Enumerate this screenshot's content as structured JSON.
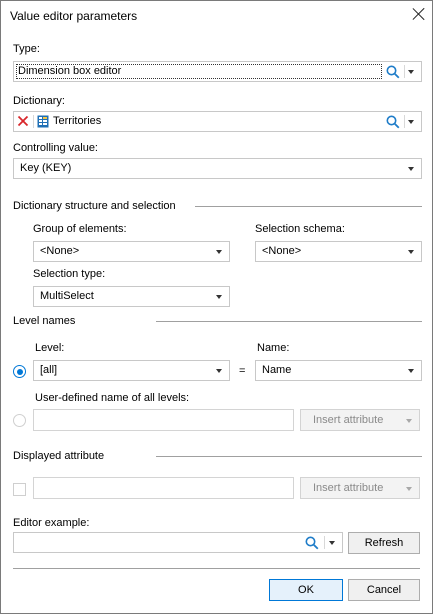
{
  "window": {
    "title": "Value editor parameters"
  },
  "type": {
    "label": "Type:",
    "value": "Dimension box editor"
  },
  "dictionary": {
    "label": "Dictionary:",
    "value": "Territories"
  },
  "controlling": {
    "label": "Controlling value:",
    "value": "Key (KEY)"
  },
  "structure": {
    "title": "Dictionary structure and selection",
    "group_label": "Group of elements:",
    "group_value": "<None>",
    "schema_label": "Selection schema:",
    "schema_value": "<None>",
    "seltype_label": "Selection type:",
    "seltype_value": "MultiSelect"
  },
  "levels": {
    "title": "Level names",
    "level_label": "Level:",
    "level_value": "[all]",
    "equals": "=",
    "name_label": "Name:",
    "name_value": "Name",
    "user_label": "User-defined name of all levels:",
    "user_value": "",
    "insert_label": "Insert attribute",
    "radio_level_selected": true
  },
  "displayed": {
    "title": "Displayed attribute",
    "value": "",
    "insert_label": "Insert attribute"
  },
  "example": {
    "label": "Editor example:",
    "value": "",
    "refresh_label": "Refresh"
  },
  "buttons": {
    "ok": "OK",
    "cancel": "Cancel"
  },
  "colors": {
    "accent": "#0078d7",
    "clear_red": "#d9262b",
    "dict_icon_blue": "#1f6fb5"
  },
  "icons": [
    "close-icon",
    "search-icon",
    "chevron-down-icon",
    "clear-icon",
    "dictionary-icon"
  ]
}
